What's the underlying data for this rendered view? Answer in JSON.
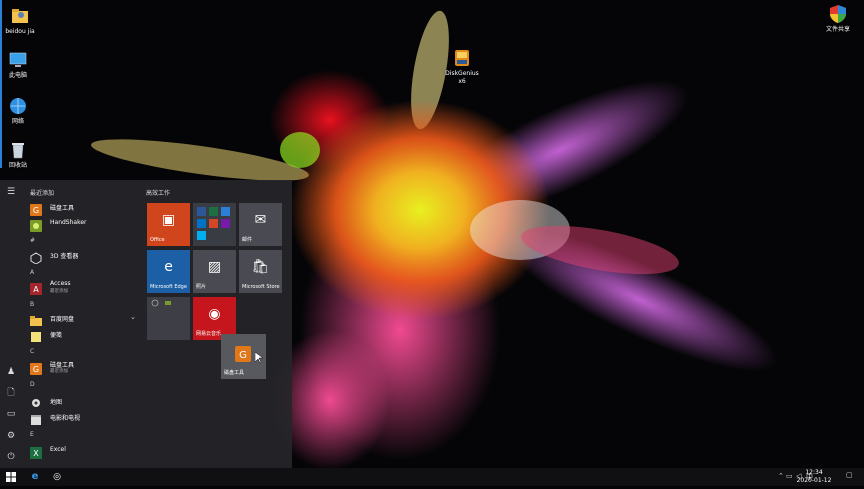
{
  "desktop": {
    "icons": [
      {
        "label": "beidou jia",
        "icon": "user-folder-icon"
      },
      {
        "label": "此电脑",
        "icon": "computer-icon"
      },
      {
        "label": "网络",
        "icon": "network-icon"
      },
      {
        "label": "回收站",
        "icon": "recycle-bin-icon"
      },
      {
        "label": "DiskGenius",
        "label2": "x6",
        "icon": "diskgenius-icon"
      },
      {
        "label": "文件共享",
        "icon": "shield-share-icon"
      }
    ]
  },
  "start_menu": {
    "recent_header": "最近添加",
    "tiles_header": "高效工作",
    "apps": [
      {
        "label": "磁盘工具"
      },
      {
        "label": "HandShaker"
      },
      {
        "letter": "#"
      },
      {
        "label": "3D 查看器"
      },
      {
        "letter": "A"
      },
      {
        "label": "Access",
        "sub": "最近添加"
      },
      {
        "letter": "B"
      },
      {
        "label": "百度网盘"
      },
      {
        "label": "便笺"
      },
      {
        "letter": "C"
      },
      {
        "label": "磁盘工具",
        "sub": "最近添加"
      },
      {
        "letter": "D"
      },
      {
        "label": "地图"
      },
      {
        "label": "电影和电视"
      },
      {
        "letter": "E"
      },
      {
        "label": "Excel"
      }
    ],
    "tiles": [
      {
        "label": "Office"
      },
      {
        "label": ""
      },
      {
        "label": "邮件"
      },
      {
        "label": "Microsoft Edge"
      },
      {
        "label": "照片"
      },
      {
        "label": "Microsoft Store"
      },
      {
        "label": ""
      },
      {
        "label": "网易云音乐"
      }
    ],
    "drag_tile": {
      "label": "磁盘工具"
    }
  },
  "taskbar": {
    "ime": "中",
    "time": "12:34",
    "date": "2020-01-12"
  },
  "colors": {
    "accent": "#2b7fd6",
    "office": "#d0451b",
    "edge": "#1d5fa5",
    "music": "#c4161c"
  }
}
